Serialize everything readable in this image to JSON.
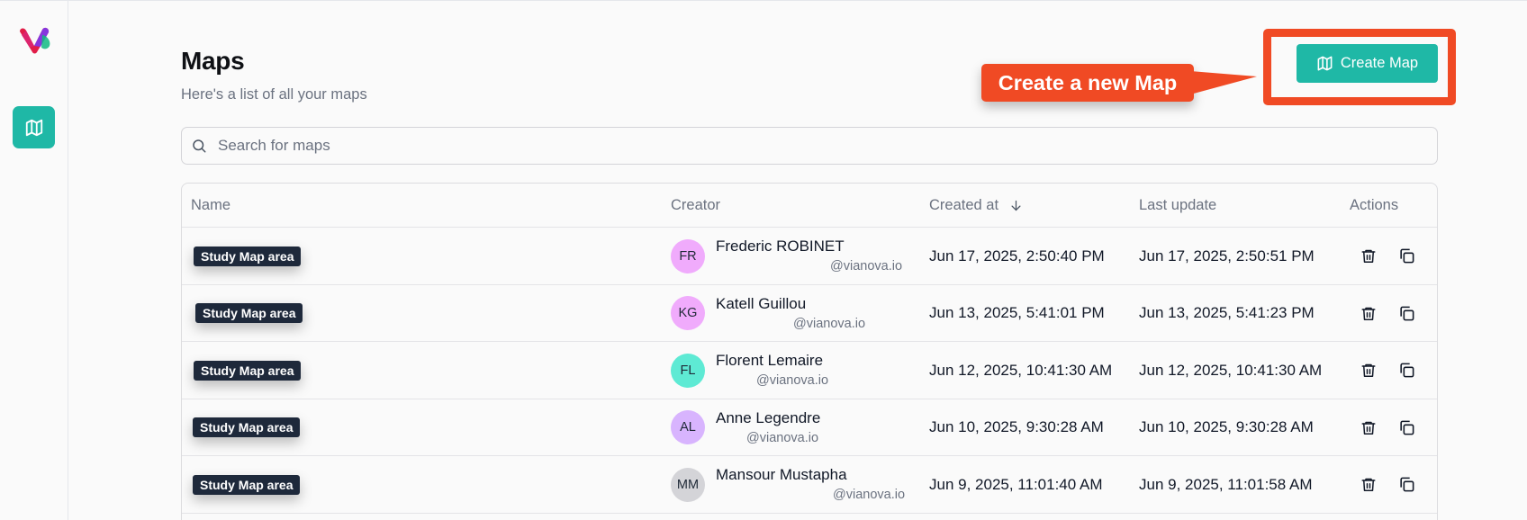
{
  "page": {
    "title": "Maps",
    "subtitle": "Here's a list of all your maps"
  },
  "toolbar": {
    "create_label": "Create Map"
  },
  "annotation": {
    "callout_text": "Create a new Map",
    "color": "#f04a24"
  },
  "search": {
    "placeholder": "Search for maps"
  },
  "table": {
    "headers": {
      "name": "Name",
      "creator": "Creator",
      "created_at": "Created at",
      "last_update": "Last update",
      "actions": "Actions"
    },
    "rows": [
      {
        "name": "Study Map area",
        "initials": "FR",
        "avatar_color": "#f0abfc",
        "creator": "Frederic ROBINET",
        "email": "@vianova.io",
        "created_at": "Jun 17, 2025, 2:50:40 PM",
        "last_update": "Jun 17, 2025, 2:50:51 PM"
      },
      {
        "name": "Study Map area",
        "initials": "KG",
        "avatar_color": "#f0abfc",
        "creator": "Katell Guillou",
        "email": "@vianova.io",
        "created_at": "Jun 13, 2025, 5:41:01 PM",
        "last_update": "Jun 13, 2025, 5:41:23 PM"
      },
      {
        "name": "Study Map area",
        "initials": "FL",
        "avatar_color": "#5eead4",
        "creator": "Florent Lemaire",
        "email": "@vianova.io",
        "created_at": "Jun 12, 2025, 10:41:30 AM",
        "last_update": "Jun 12, 2025, 10:41:30 AM"
      },
      {
        "name": "Study Map area",
        "initials": "AL",
        "avatar_color": "#d8b4fe",
        "creator": "Anne Legendre",
        "email": "@vianova.io",
        "created_at": "Jun 10, 2025, 9:30:28 AM",
        "last_update": "Jun 10, 2025, 9:30:28 AM"
      },
      {
        "name": "Study Map area",
        "initials": "MM",
        "avatar_color": "#d4d4d8",
        "creator": "Mansour Mustapha",
        "email": "@vianova.io",
        "created_at": "Jun 9, 2025, 11:01:40 AM",
        "last_update": "Jun 9, 2025, 11:01:58 AM"
      }
    ]
  },
  "icons": {
    "logo": "vianova-logo",
    "nav": "map-icon",
    "search": "search-icon",
    "sort": "arrow-down-icon",
    "delete": "trash-icon",
    "copy": "copy-icon"
  },
  "colors": {
    "accent": "#1fb8a6",
    "tag_bg": "#1e293b"
  }
}
